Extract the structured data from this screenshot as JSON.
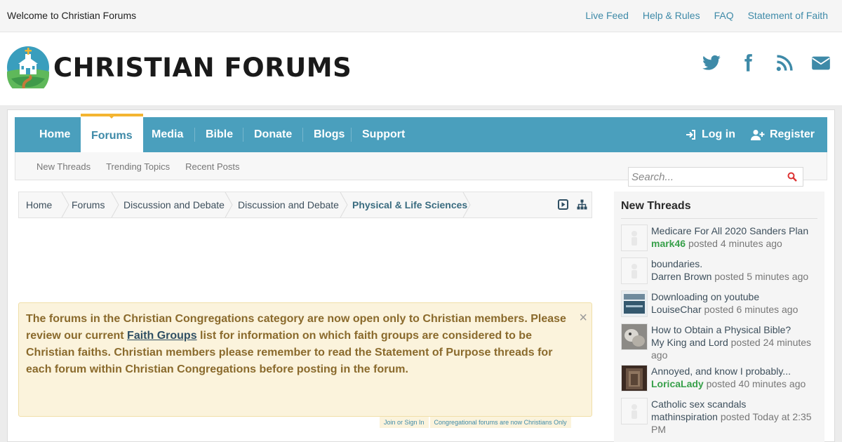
{
  "topbar": {
    "welcome": "Welcome to Christian Forums",
    "links": [
      "Live Feed",
      "Help & Rules",
      "FAQ",
      "Statement of Faith"
    ]
  },
  "brand": {
    "title": "CHRISTIAN FORUMS",
    "logo_icon": "church-logo-icon"
  },
  "social_icons": [
    "twitter-icon",
    "facebook-icon",
    "rss-icon",
    "envelope-icon"
  ],
  "nav": {
    "tabs": [
      "Home",
      "Forums",
      "Media",
      "Bible",
      "Donate",
      "Blogs",
      "Support"
    ],
    "active_tab": "Forums",
    "login": "Log in",
    "register": "Register"
  },
  "subnav": {
    "links": [
      "New Threads",
      "Trending Topics",
      "Recent Posts"
    ]
  },
  "search": {
    "placeholder": "Search..."
  },
  "breadcrumbs": [
    "Home",
    "Forums",
    "Discussion and Debate",
    "Discussion and Debate",
    "Physical & Life Sciences"
  ],
  "notice": {
    "text_before": "The forums in the Christian Congregations category are now open only to Christian members. Please review our current ",
    "link": "Faith Groups",
    "text_after": " list for information on which faith groups are considered to be Christian faiths. Christian members please remember to read the Statement of Purpose threads for each forum within Christian Congregations before posting in the forum.",
    "close": "×"
  },
  "tags": [
    "Join or Sign In",
    "Congregational forums are now Christians Only"
  ],
  "sidebar": {
    "title": "New Threads",
    "posted_word": "posted",
    "threads": [
      {
        "title": "Medicare For All 2020 Sanders Plan",
        "user": "mark46",
        "time": "4 minutes ago"
      },
      {
        "title": "boundaries.",
        "user": "Darren Brown",
        "time": "5 minutes ago"
      },
      {
        "title": "Downloading on youtube",
        "user": "LouiseChar",
        "time": "6 minutes ago"
      },
      {
        "title": "How to Obtain a Physical Bible?",
        "user": "My King and Lord",
        "time": "24 minutes ago"
      },
      {
        "title": "Annoyed, and know I probably...",
        "user": "LoricaLady",
        "time": "40 minutes ago"
      },
      {
        "title": "Catholic sex scandals",
        "user": "mathinspiration",
        "time": "Today at 2:35 PM"
      }
    ]
  },
  "colors": {
    "nav": "#4a9fbd",
    "active_accent": "#f4b531",
    "link": "#3e8aa8",
    "notice_bg": "#fbf3dc",
    "notice_text": "#8a6a2c",
    "green_user": "#37a04a"
  }
}
